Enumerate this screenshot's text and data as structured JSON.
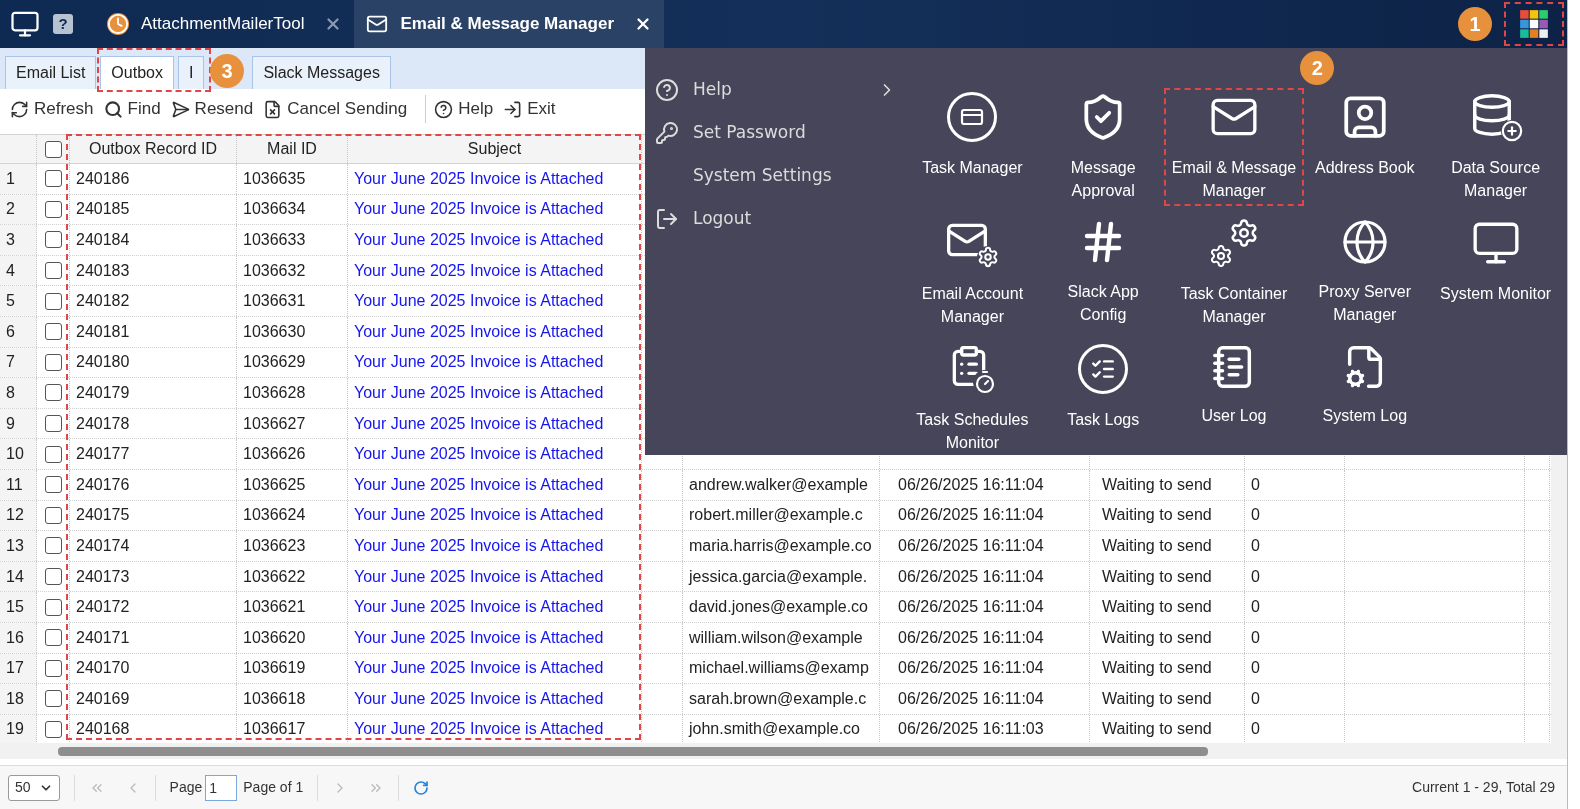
{
  "title_bar": {
    "help_glyph": "?",
    "tabs": [
      {
        "label": "AttachmentMailerTool",
        "selected": false
      },
      {
        "label": "Email & Message Manager",
        "selected": true
      }
    ]
  },
  "module_tabs": [
    {
      "label": "Email List",
      "selected": false
    },
    {
      "label": "Outbox",
      "selected": true
    },
    {
      "label": "I",
      "selected": false
    },
    {
      "label": "Slack Messages",
      "selected": false
    }
  ],
  "toolbar": {
    "groups": [
      [
        {
          "label": "Refresh"
        },
        {
          "label": "Find"
        },
        {
          "label": "Resend"
        },
        {
          "label": "Cancel Sending"
        }
      ],
      [
        {
          "label": "Help"
        },
        {
          "label": "Exit"
        }
      ]
    ]
  },
  "table": {
    "columns": [
      "Outbox Record ID",
      "Mail ID",
      "Subject"
    ],
    "select_all_checked": false,
    "rows": [
      {
        "number": "1",
        "checked": false,
        "record_id": "240186",
        "mail_id": "1036635",
        "subject": "Your June 2025 Invoice is Attached"
      },
      {
        "number": "2",
        "checked": false,
        "record_id": "240185",
        "mail_id": "1036634",
        "subject": "Your June 2025 Invoice is Attached"
      },
      {
        "number": "3",
        "checked": false,
        "record_id": "240184",
        "mail_id": "1036633",
        "subject": "Your June 2025 Invoice is Attached"
      },
      {
        "number": "4",
        "checked": false,
        "record_id": "240183",
        "mail_id": "1036632",
        "subject": "Your June 2025 Invoice is Attached"
      },
      {
        "number": "5",
        "checked": false,
        "record_id": "240182",
        "mail_id": "1036631",
        "subject": "Your June 2025 Invoice is Attached"
      },
      {
        "number": "6",
        "checked": false,
        "record_id": "240181",
        "mail_id": "1036630",
        "subject": "Your June 2025 Invoice is Attached"
      },
      {
        "number": "7",
        "checked": false,
        "record_id": "240180",
        "mail_id": "1036629",
        "subject": "Your June 2025 Invoice is Attached"
      },
      {
        "number": "8",
        "checked": false,
        "record_id": "240179",
        "mail_id": "1036628",
        "subject": "Your June 2025 Invoice is Attached"
      },
      {
        "number": "9",
        "checked": false,
        "record_id": "240178",
        "mail_id": "1036627",
        "subject": "Your June 2025 Invoice is Attached"
      },
      {
        "number": "10",
        "checked": false,
        "record_id": "240177",
        "mail_id": "1036626",
        "subject": "Your June 2025 Invoice is Attached"
      },
      {
        "number": "11",
        "checked": false,
        "record_id": "240176",
        "mail_id": "1036625",
        "subject": "Your June 2025 Invoice is Attached",
        "recipient": "andrew.walker@example",
        "created": "06/26/2025 16:11:04",
        "status": "Waiting to send",
        "attempts": "0"
      },
      {
        "number": "12",
        "checked": false,
        "record_id": "240175",
        "mail_id": "1036624",
        "subject": "Your June 2025 Invoice is Attached",
        "recipient": "robert.miller@example.c",
        "created": "06/26/2025 16:11:04",
        "status": "Waiting to send",
        "attempts": "0"
      },
      {
        "number": "13",
        "checked": false,
        "record_id": "240174",
        "mail_id": "1036623",
        "subject": "Your June 2025 Invoice is Attached",
        "recipient": "maria.harris@example.co",
        "created": "06/26/2025 16:11:04",
        "status": "Waiting to send",
        "attempts": "0"
      },
      {
        "number": "14",
        "checked": false,
        "record_id": "240173",
        "mail_id": "1036622",
        "subject": "Your June 2025 Invoice is Attached",
        "recipient": "jessica.garcia@example.",
        "created": "06/26/2025 16:11:04",
        "status": "Waiting to send",
        "attempts": "0"
      },
      {
        "number": "15",
        "checked": false,
        "record_id": "240172",
        "mail_id": "1036621",
        "subject": "Your June 2025 Invoice is Attached",
        "recipient": "david.jones@example.co",
        "created": "06/26/2025 16:11:04",
        "status": "Waiting to send",
        "attempts": "0"
      },
      {
        "number": "16",
        "checked": false,
        "record_id": "240171",
        "mail_id": "1036620",
        "subject": "Your June 2025 Invoice is Attached",
        "recipient": "william.wilson@example",
        "created": "06/26/2025 16:11:04",
        "status": "Waiting to send",
        "attempts": "0"
      },
      {
        "number": "17",
        "checked": false,
        "record_id": "240170",
        "mail_id": "1036619",
        "subject": "Your June 2025 Invoice is Attached",
        "recipient": "michael.williams@examp",
        "created": "06/26/2025 16:11:04",
        "status": "Waiting to send",
        "attempts": "0"
      },
      {
        "number": "18",
        "checked": false,
        "record_id": "240169",
        "mail_id": "1036618",
        "subject": "Your June 2025 Invoice is Attached",
        "recipient": "sarah.brown@example.c",
        "created": "06/26/2025 16:11:04",
        "status": "Waiting to send",
        "attempts": "0"
      },
      {
        "number": "19",
        "checked": false,
        "record_id": "240168",
        "mail_id": "1036617",
        "subject": "Your June 2025 Invoice is Attached",
        "recipient": "john.smith@example.co",
        "created": "06/26/2025 16:11:03",
        "status": "Waiting to send",
        "attempts": "0"
      }
    ]
  },
  "pager": {
    "page_size": "50",
    "page_label": "Page",
    "page": "1",
    "page_of": "Page of 1",
    "summary": "Current 1 - 29, Total 29"
  },
  "menu": {
    "items": [
      {
        "label": "Help",
        "submenu": true
      },
      {
        "label": "Set Password",
        "submenu": false
      },
      {
        "label": "System Settings",
        "submenu": false
      },
      {
        "label": "Logout",
        "submenu": false
      }
    ],
    "apps": [
      {
        "label": "Task Manager",
        "highlighted": false
      },
      {
        "label": "Message\nApproval",
        "highlighted": false
      },
      {
        "label": "Email & Message\nManager",
        "highlighted": true
      },
      {
        "label": "Address Book",
        "highlighted": false
      },
      {
        "label": "Data Source\nManager",
        "highlighted": false
      },
      {
        "label": "Email Account\nManager",
        "highlighted": false
      },
      {
        "label": "Slack App\nConfig",
        "highlighted": false
      },
      {
        "label": "Task Container\nManager",
        "highlighted": false
      },
      {
        "label": "Proxy Server\nManager",
        "highlighted": false
      },
      {
        "label": "System Monitor",
        "highlighted": false
      },
      {
        "label": "Task Schedules\nMonitor",
        "highlighted": false
      },
      {
        "label": "Task Logs",
        "highlighted": false
      },
      {
        "label": "User Log",
        "highlighted": false
      },
      {
        "label": "System Log",
        "highlighted": false
      }
    ]
  },
  "callouts": [
    {
      "label": "1"
    },
    {
      "label": "2"
    },
    {
      "label": "3"
    }
  ]
}
